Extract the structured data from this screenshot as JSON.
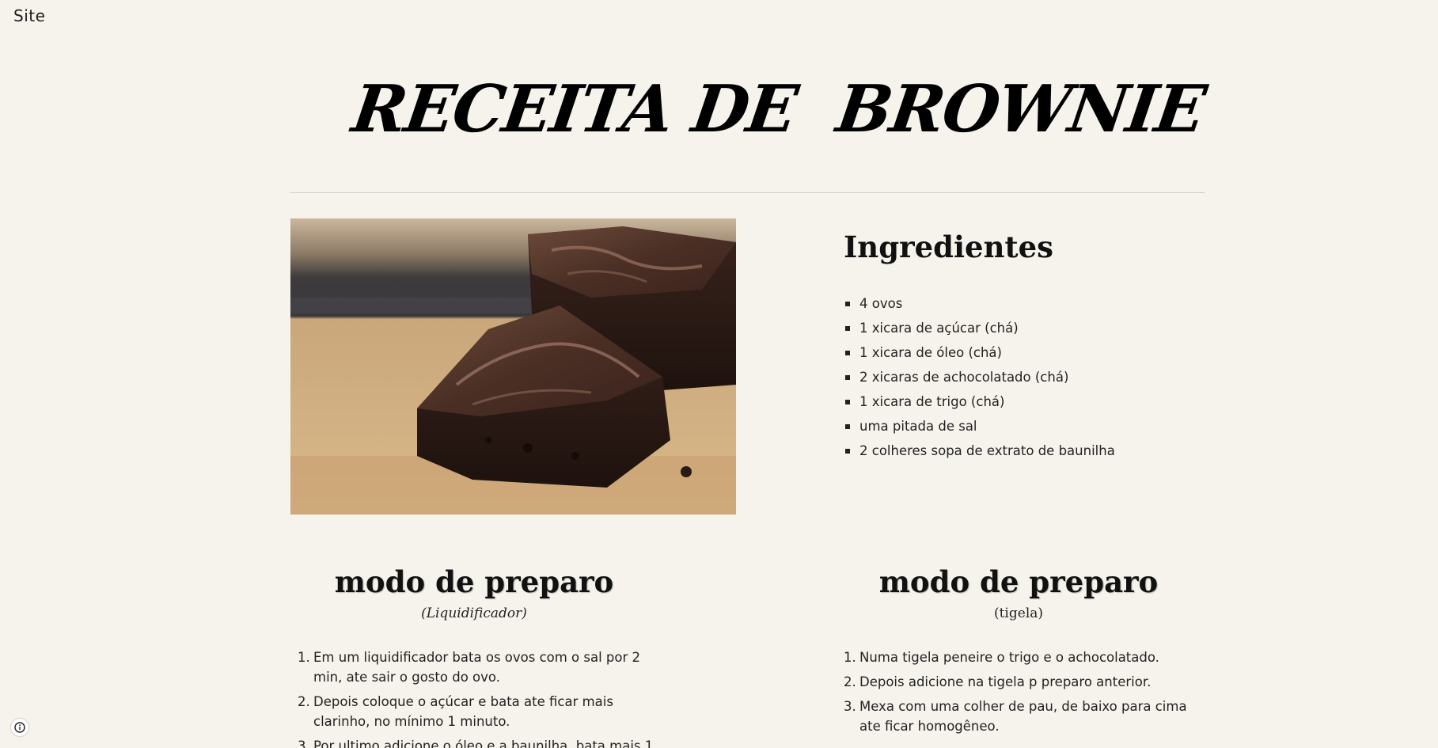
{
  "site": {
    "title": "Site"
  },
  "hero": {
    "title": "RECEITA DE  BROWNIE"
  },
  "ingredients": {
    "title": "Ingredientes",
    "items": [
      "4 ovos",
      "1 xicara de açúcar (chá)",
      "1 xicara de óleo (chá)",
      "2 xicaras de achocolatado (chá)",
      "1 xicara de trigo (chá)",
      "uma pitada de sal",
      "2 colheres sopa de extrato de baunilha"
    ]
  },
  "method_blender": {
    "title": "modo de preparo",
    "subtitle": "(Liquidificador)",
    "steps": [
      {
        "n": "1.",
        "text": "Em um liquidificador bata os ovos com o sal por 2 min, ate sair o gosto do ovo."
      },
      {
        "n": "2.",
        "text": "Depois coloque o açúcar e bata ate ficar mais clarinho, no mínimo 1 minuto."
      },
      {
        "n": "3.",
        "text": "Por ultimo adicione o óleo e a baunilha, bata mais 1"
      }
    ]
  },
  "method_bowl": {
    "title": "modo de preparo",
    "subtitle": "(tigela)",
    "steps": [
      {
        "n": "1.",
        "text": "Numa tigela peneire o trigo e o achocolatado."
      },
      {
        "n": "2.",
        "text": "Depois adicione na tigela p preparo anterior."
      },
      {
        "n": "3.",
        "text": "Mexa com uma colher de pau, de baixo para cima ate ficar homogêneo."
      }
    ]
  },
  "icons": {
    "photo": "brownie-photo",
    "info": "info-icon"
  },
  "colors": {
    "background": "#f6f3ec",
    "text": "#212121",
    "divider": "#cfccc5"
  }
}
